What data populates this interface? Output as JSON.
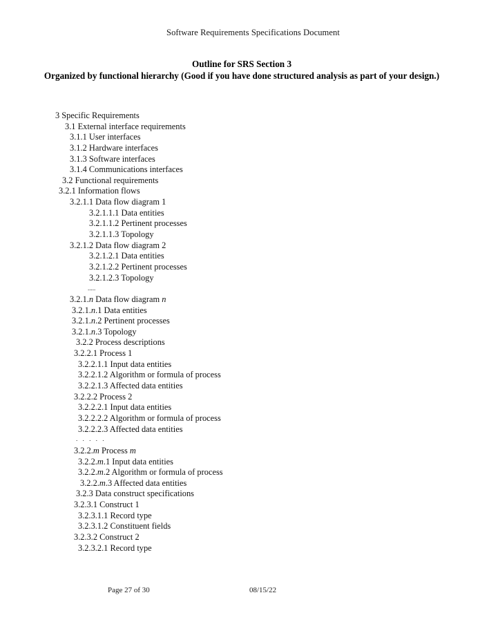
{
  "header": {
    "running_title": "Software Requirements Specifications Document"
  },
  "title_block": {
    "line1": "Outline for SRS Section 3",
    "line2": "Organized by functional hierarchy (Good if you have done structured analysis as part of your design.)"
  },
  "outline": {
    "items": [
      {
        "text": "3  Specific Requirements",
        "indent": "i0"
      },
      {
        "text": "3.1  External interface requirements",
        "indent": "i1"
      },
      {
        "text": "3.1.1 User interfaces",
        "indent": "i2"
      },
      {
        "text": "3.1.2 Hardware interfaces",
        "indent": "i2"
      },
      {
        "text": "3.1.3 Software interfaces",
        "indent": "i2"
      },
      {
        "text": "3.1.4 Communications interfaces",
        "indent": "i2"
      },
      {
        "text": "3.2 Functional requirements",
        "indent": "i2b"
      },
      {
        "text": "3.2.1  Information flows",
        "indent": "i2c"
      },
      {
        "text": "3.2.1.1  Data flow diagram 1",
        "indent": "i2"
      },
      {
        "text": "3.2.1.1.1 Data entities",
        "indent": "i3"
      },
      {
        "text": "3.2.1.1.2 Pertinent processes",
        "indent": "i3"
      },
      {
        "text": "3.2.1.1.3 Topology",
        "indent": "i3"
      },
      {
        "text": "3.2.1.2  Data flow diagram 2",
        "indent": "i2"
      },
      {
        "text": "3.2.1.2.1 Data entities",
        "indent": "i3"
      },
      {
        "text": "3.2.1.2.2 Pertinent processes",
        "indent": "i3"
      },
      {
        "text": "3.2.1.2.3 Topology",
        "indent": "i3"
      },
      {
        "text": ".....",
        "indent": "ellipsis-tight",
        "kind": "ellipsis"
      },
      {
        "text": "3.2.1.@n@ Data flow diagram @n@",
        "indent": "i2"
      },
      {
        "text": "3.2.1.@n@.1 Data entities",
        "indent": "i4"
      },
      {
        "text": "3.2.1.@n@.2 Pertinent processes",
        "indent": "i4"
      },
      {
        "text": "3.2.1.@n@.3 Topology",
        "indent": "i4"
      },
      {
        "text": "3.2.2 Process descriptions",
        "indent": "i5"
      },
      {
        "text": "3.2.2.1 Process 1",
        "indent": "i6"
      },
      {
        "text": "3.2.2.1.1 Input data entities",
        "indent": "i7"
      },
      {
        "text": "3.2.2.1.2 Algorithm or formula of process",
        "indent": "i7"
      },
      {
        "text": "3.2.2.1.3 Affected data entities",
        "indent": "i7"
      },
      {
        "text": "3.2.2.2 Process 2",
        "indent": "i6"
      },
      {
        "text": "3.2.2.2.1 Input data entities",
        "indent": "i7"
      },
      {
        "text": "3.2.2.2.2 Algorithm or formula of process",
        "indent": "i7"
      },
      {
        "text": "3.2.2.2.3 Affected data entities",
        "indent": "i7"
      },
      {
        "text": ". . . . .",
        "indent": "ellipsis-wide",
        "kind": "ellipsis"
      },
      {
        "text": "3.2.2.@m@ Process @m@",
        "indent": "i6"
      },
      {
        "text": "3.2.2.@m@.1 Input data entities",
        "indent": "i7"
      },
      {
        "text": "3.2.2.@m@.2 Algorithm or formula of process",
        "indent": "i7"
      },
      {
        "text": "3.2.2.@m@.3 Affected data entities",
        "indent": "i8"
      },
      {
        "text": "3.2.3 Data construct specifications",
        "indent": "i5"
      },
      {
        "text": "3.2.3.1 Construct 1",
        "indent": "i6"
      },
      {
        "text": "3.2.3.1.1 Record type",
        "indent": "i7"
      },
      {
        "text": "3.2.3.1.2 Constituent fields",
        "indent": "i7"
      },
      {
        "text": "3.2.3.2 Construct 2",
        "indent": "i6"
      },
      {
        "text": "3.2.3.2.1 Record type",
        "indent": "i7"
      }
    ]
  },
  "footer": {
    "page_label": "Page 27 of 30",
    "date": "08/15/22"
  }
}
